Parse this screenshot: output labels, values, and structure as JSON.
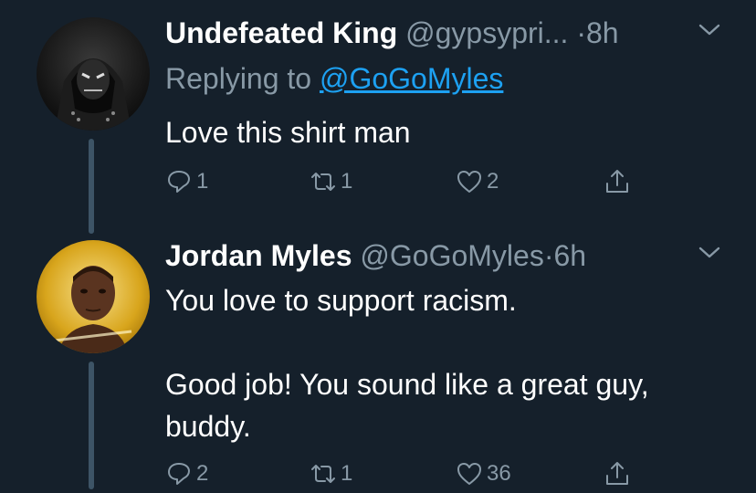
{
  "tweets": [
    {
      "name": "Undefeated King",
      "handle": "@gypsypri...",
      "dot": "·",
      "time": "8h",
      "replying_prefix": "Replying to ",
      "replying_to": "@GoGoMyles",
      "text": "Love this shirt man",
      "replies": "1",
      "retweets": "1",
      "likes": "2",
      "avatar_icon": "masked-hooded-figure-avatar"
    },
    {
      "name": "Jordan Myles",
      "handle": "@GoGoMyles",
      "dot": "·",
      "time": "6h",
      "text": "You love to support racism.\n\nGood job! You sound like a great guy, buddy.",
      "replies": "2",
      "retweets": "1",
      "likes": "36",
      "avatar_icon": "wrestler-portrait-avatar"
    }
  ],
  "icons": {
    "reply": "reply-icon",
    "retweet": "retweet-icon",
    "like": "heart-icon",
    "share": "share-icon",
    "menu": "chevron-down-icon"
  },
  "colors": {
    "background": "#15202b",
    "text": "#ffffff",
    "muted": "#8899a6",
    "link": "#1da1f2",
    "thread_line": "#3d5466"
  }
}
